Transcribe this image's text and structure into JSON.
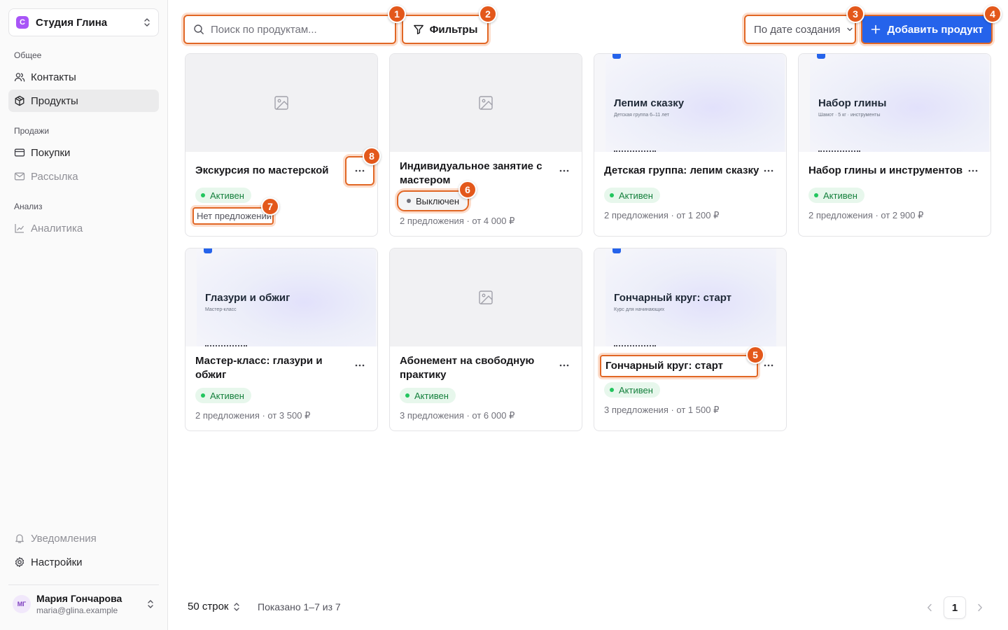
{
  "org": {
    "initial": "С",
    "name": "Студия Глина"
  },
  "nav": {
    "general_label": "Общее",
    "contacts": "Контакты",
    "products": "Продукты",
    "sales_label": "Продажи",
    "purchases": "Покупки",
    "mailing": "Рассылка",
    "analysis_label": "Анализ",
    "analytics": "Аналитика",
    "notifications": "Уведомления",
    "settings": "Настройки"
  },
  "user": {
    "initials": "МГ",
    "name": "Мария Гончарова",
    "email": "maria@glina.example"
  },
  "toolbar": {
    "search_placeholder": "Поиск по продуктам...",
    "filters_label": "Фильтры",
    "sort_label": "По дате создания",
    "add_label": "Добавить продукт"
  },
  "markers": [
    "1",
    "2",
    "3",
    "4",
    "5",
    "6",
    "7",
    "8"
  ],
  "products": [
    {
      "title": "Экскурсия по мастерской",
      "status": "Активен",
      "meta": "Нет предложений"
    },
    {
      "title": "Индивидуальное занятие с мастером",
      "status": "Выключен",
      "meta": "2 предложения · от 4 000 ₽"
    },
    {
      "title": "Детская группа: лепим сказку",
      "status": "Активен",
      "meta": "2 предложения · от 1 200 ₽",
      "cover_title": "Лепим сказку",
      "cover_sub": "Детская группа 6–11 лет"
    },
    {
      "title": "Набор глины и инструментов",
      "status": "Активен",
      "meta": "2 предложения · от 2 900 ₽",
      "cover_title": "Набор глины",
      "cover_sub": "Шамот · 5 кг · инструменты"
    },
    {
      "title": "Мастер-класс: глазури и обжиг",
      "status": "Активен",
      "meta": "2 предложения · от 3 500 ₽",
      "cover_title": "Глазури и обжиг",
      "cover_sub": "Мастер-класс"
    },
    {
      "title": "Абонемент на свободную практику",
      "status": "Активен",
      "meta": "3 предложения · от 6 000 ₽"
    },
    {
      "title": "Гончарный круг: старт",
      "status": "Активен",
      "meta": "3 предложения · от 1 500 ₽",
      "cover_title": "Гончарный круг: старт",
      "cover_sub": "Курс для начинающих"
    }
  ],
  "footer": {
    "rows_label": "50 строк",
    "shown_label": "Показано 1–7 из 7",
    "page": "1"
  },
  "colors": {
    "accent": "#2563eb",
    "highlight": "#e16725",
    "active_status": "#15803d"
  }
}
